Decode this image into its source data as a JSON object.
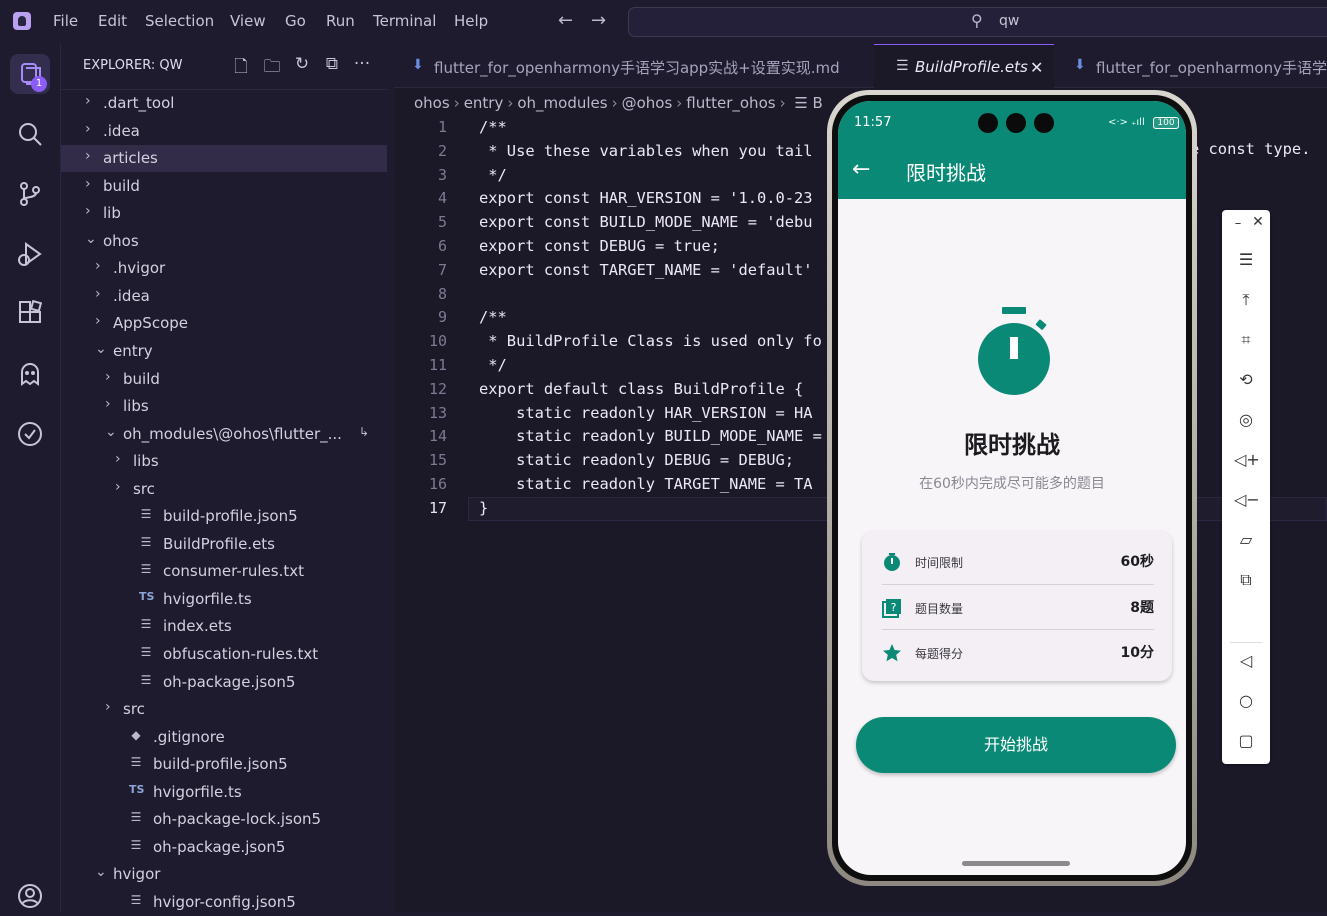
{
  "menu": [
    "File",
    "Edit",
    "Selection",
    "View",
    "Go",
    "Run",
    "Terminal",
    "Help"
  ],
  "command_center": {
    "text": "qw"
  },
  "activity": {
    "badge": "1"
  },
  "explorer": {
    "title": "EXPLORER: QW",
    "rows": [
      {
        "label": ".dart_tool",
        "depth": 0,
        "kind": "folder",
        "open": false
      },
      {
        "label": ".idea",
        "depth": 0,
        "kind": "folder",
        "open": false
      },
      {
        "label": "articles",
        "depth": 0,
        "kind": "folder",
        "open": false,
        "selected": true
      },
      {
        "label": "build",
        "depth": 0,
        "kind": "folder",
        "open": false
      },
      {
        "label": "lib",
        "depth": 0,
        "kind": "folder",
        "open": false
      },
      {
        "label": "ohos",
        "depth": 0,
        "kind": "folder",
        "open": true
      },
      {
        "label": ".hvigor",
        "depth": 1,
        "kind": "folder",
        "open": false
      },
      {
        "label": ".idea",
        "depth": 1,
        "kind": "folder",
        "open": false
      },
      {
        "label": "AppScope",
        "depth": 1,
        "kind": "folder",
        "open": false
      },
      {
        "label": "entry",
        "depth": 1,
        "kind": "folder",
        "open": true
      },
      {
        "label": "build",
        "depth": 2,
        "kind": "folder",
        "open": false
      },
      {
        "label": "libs",
        "depth": 2,
        "kind": "folder",
        "open": false
      },
      {
        "label": "oh_modules\\@ohos\\flutter_...",
        "depth": 2,
        "kind": "folder",
        "open": true,
        "link": true
      },
      {
        "label": "libs",
        "depth": 3,
        "kind": "folder",
        "open": false
      },
      {
        "label": "src",
        "depth": 3,
        "kind": "folder",
        "open": false
      },
      {
        "label": "build-profile.json5",
        "depth": 3,
        "kind": "file"
      },
      {
        "label": "BuildProfile.ets",
        "depth": 3,
        "kind": "file"
      },
      {
        "label": "consumer-rules.txt",
        "depth": 3,
        "kind": "file"
      },
      {
        "label": "hvigorfile.ts",
        "depth": 3,
        "kind": "ts"
      },
      {
        "label": "index.ets",
        "depth": 3,
        "kind": "file"
      },
      {
        "label": "obfuscation-rules.txt",
        "depth": 3,
        "kind": "file"
      },
      {
        "label": "oh-package.json5",
        "depth": 3,
        "kind": "file"
      },
      {
        "label": "src",
        "depth": 2,
        "kind": "folder",
        "open": false
      },
      {
        "label": ".gitignore",
        "depth": 2,
        "kind": "git"
      },
      {
        "label": "build-profile.json5",
        "depth": 2,
        "kind": "file"
      },
      {
        "label": "hvigorfile.ts",
        "depth": 2,
        "kind": "ts"
      },
      {
        "label": "oh-package-lock.json5",
        "depth": 2,
        "kind": "file"
      },
      {
        "label": "oh-package.json5",
        "depth": 2,
        "kind": "file"
      },
      {
        "label": "hvigor",
        "depth": 1,
        "kind": "folder",
        "open": true
      },
      {
        "label": "hvigor-config.json5",
        "depth": 2,
        "kind": "file"
      }
    ]
  },
  "tabs": [
    {
      "label": "flutter_for_openharmony手语学习app实战+设置实现.md",
      "active": false
    },
    {
      "label": "BuildProfile.ets",
      "active": true
    },
    {
      "label": "flutter_for_openharmony手语学习app实战+设置实现.md",
      "active": false
    }
  ],
  "breadcrumbs": [
    "ohos",
    "entry",
    "oh_modules",
    "@ohos",
    "flutter_ohos"
  ],
  "breadcrumb_tail": "B",
  "code": {
    "lines": [
      "/**",
      " * Use these variables when you tail",
      " */",
      "export const HAR_VERSION = '1.0.0-23",
      "export const BUILD_MODE_NAME = 'debu",
      "export const DEBUG = true;",
      "export const TARGET_NAME = 'default'",
      "",
      "/**",
      " * BuildProfile Class is used only fo",
      " */",
      "export default class BuildProfile {",
      "    static readonly HAR_VERSION = HA",
      "    static readonly BUILD_MODE_NAME =",
      "    static readonly DEBUG = DEBUG;",
      "    static readonly TARGET_NAME = TA",
      "}"
    ],
    "current_line": 17,
    "tail_text": "e const type."
  },
  "phone": {
    "time": "11:57",
    "signal": "<·> ₊ıll",
    "battery": "100",
    "appbar_title": "限时挑战",
    "hero_title": "限时挑战",
    "hero_subtitle": "在60秒内完成尽可能多的题目",
    "info": [
      {
        "label": "时间限制",
        "value": "60秒",
        "icon": "timer-icon"
      },
      {
        "label": "题目数量",
        "value": "8题",
        "icon": "quiz-icon"
      },
      {
        "label": "每题得分",
        "value": "10分",
        "icon": "star-icon"
      }
    ],
    "start_label": "开始挑战",
    "accent": "#0a8a76"
  }
}
